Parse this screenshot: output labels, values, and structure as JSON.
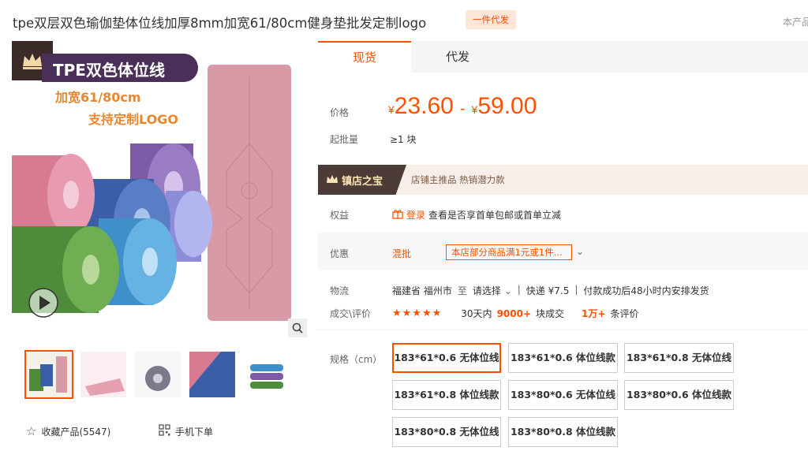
{
  "title": "tpe双层双色瑜伽垫体位线加厚8mm加宽61/80cm健身垫批发定制logo",
  "badge": "一件代发",
  "cut_text": "本产品",
  "image": {
    "banner": "TPE双色体位线",
    "line1": "加宽61/80cm",
    "line2": "支持定制LOGO"
  },
  "tabs": [
    "现货",
    "代发"
  ],
  "price": {
    "label": "价格",
    "currency": "¥",
    "min": "23.60",
    "max": "59.00",
    "dash": "-"
  },
  "moq": {
    "label": "起批量",
    "value": "≥1 块"
  },
  "treasure": {
    "title": "镇店之宝",
    "tags": "店铺主推品   热销潜力款"
  },
  "rights": {
    "label": "权益",
    "login": "登录",
    "text": "查看是否享首单包邮或首单立减"
  },
  "promo": {
    "label": "优惠",
    "type": "混批",
    "text": "本店部分商品满1元或1件...",
    "arrow": "⌄"
  },
  "shipping": {
    "label": "物流",
    "from": "福建省 福州市",
    "to_word": "至",
    "to": "请选择",
    "express": "快递 ¥7.5",
    "note": "付款成功后48小时内安排发货"
  },
  "deals": {
    "label": "成交\\评价",
    "stars": "★★★★★",
    "period": "30天内",
    "count": "9000+",
    "count_suffix": "块成交",
    "reviews": "1万+",
    "reviews_suffix": "条评价"
  },
  "specs": {
    "label": "规格（cm）",
    "items": [
      "183*61*0.6 无体位线",
      "183*61*0.6 体位线款",
      "183*61*0.8 无体位线",
      "183*61*0.8 体位线款",
      "183*80*0.6 无体位线",
      "183*80*0.6 体位线款",
      "183*80*0.8 无体位线",
      "183*80*0.8 体位线款"
    ],
    "selected_index": 0
  },
  "footer": {
    "favorite": "收藏产品(5547)",
    "mobile": "手机下单"
  },
  "colors": {
    "accent": "#ff5000",
    "treasure_dark": "#4c3b36"
  }
}
